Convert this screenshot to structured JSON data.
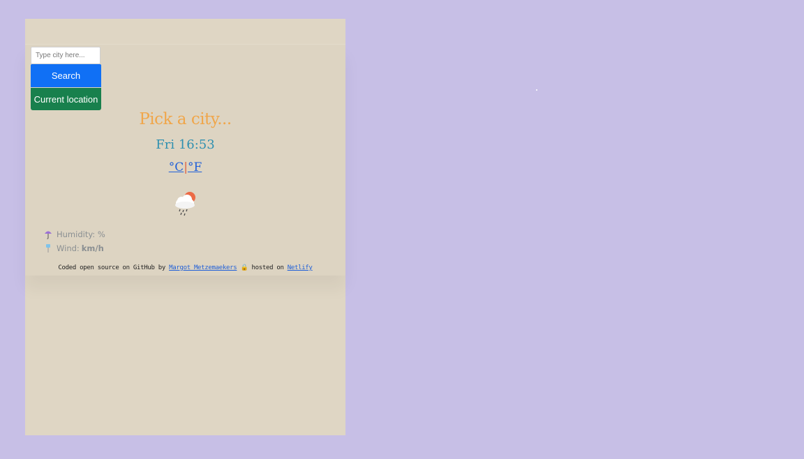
{
  "search": {
    "placeholder": "Type city here...",
    "search_label": "Search",
    "location_label": "Current location"
  },
  "main": {
    "city": "Pick a city...",
    "date_time": "Fri 16:53",
    "unit_celsius": "°C",
    "unit_separator": "|",
    "unit_fahrenheit": "°F",
    "weather_icon": "rain-cloud-sun-icon"
  },
  "details": {
    "humidity_label": "Humidity:",
    "humidity_unit": "%",
    "wind_label": "Wind:",
    "wind_unit": "km/h"
  },
  "footer": {
    "prefix": "Coded open source on GitHub",
    "by": " by ",
    "author": "Margot Metzemaekers",
    "lock_icon": "🔒",
    "hosted": " hosted on ",
    "host": "Netlify"
  },
  "colors": {
    "background": "#c7bfe6",
    "panel": "#dfd6c4",
    "search_button": "#1070f5",
    "location_button": "#18804d",
    "city": "#f0a64a",
    "date": "#2d8fb0",
    "link": "#1f5fd8"
  }
}
